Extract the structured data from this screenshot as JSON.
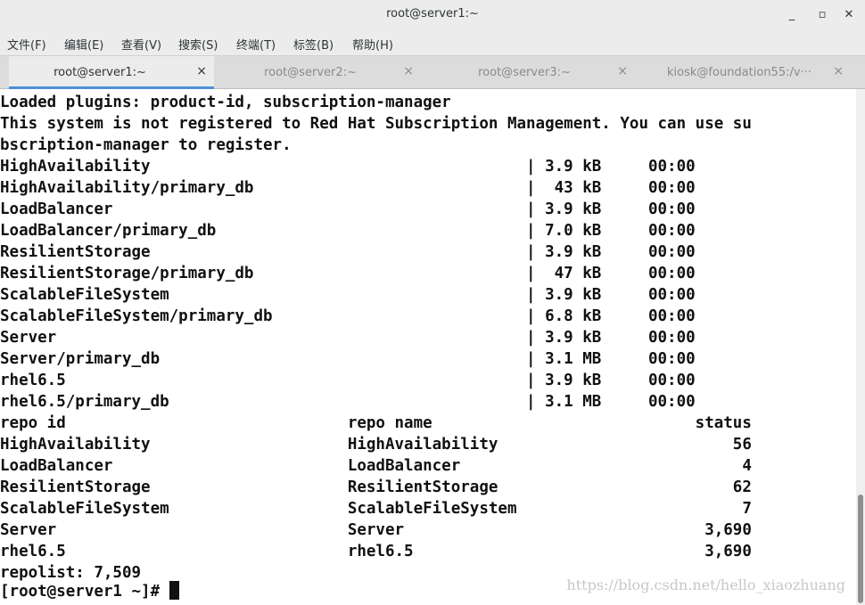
{
  "window": {
    "title": "root@server1:~",
    "minimize_icon": "_",
    "maximize_icon": "▫",
    "close_icon": "✕"
  },
  "menu": [
    "文件(F)",
    "编辑(E)",
    "查看(V)",
    "搜索(S)",
    "终端(T)",
    "标签(B)",
    "帮助(H)"
  ],
  "tabs": [
    {
      "label": "root@server1:~",
      "active": true
    },
    {
      "label": "root@server2:~",
      "active": false
    },
    {
      "label": "root@server3:~",
      "active": false
    },
    {
      "label": "kiosk@foundation55:/v···",
      "active": false
    }
  ],
  "tab_close_icon": "×",
  "terminal": {
    "lines": [
      "Loaded plugins: product-id, subscription-manager",
      "This system is not registered to Red Hat Subscription Management. You can use su",
      "bscription-manager to register.",
      "HighAvailability                                        | 3.9 kB     00:00",
      "HighAvailability/primary_db                             |  43 kB     00:00",
      "LoadBalancer                                            | 3.9 kB     00:00",
      "LoadBalancer/primary_db                                 | 7.0 kB     00:00",
      "ResilientStorage                                        | 3.9 kB     00:00",
      "ResilientStorage/primary_db                             |  47 kB     00:00",
      "ScalableFileSystem                                      | 3.9 kB     00:00",
      "ScalableFileSystem/primary_db                           | 6.8 kB     00:00",
      "Server                                                  | 3.9 kB     00:00",
      "Server/primary_db                                       | 3.1 MB     00:00",
      "rhel6.5                                                 | 3.9 kB     00:00",
      "rhel6.5/primary_db                                      | 3.1 MB     00:00",
      "repo id                              repo name                            status",
      "HighAvailability                     HighAvailability                         56",
      "LoadBalancer                         LoadBalancer                              4",
      "ResilientStorage                     ResilientStorage                         62",
      "ScalableFileSystem                   ScalableFileSystem                        7",
      "Server                               Server                                3,690",
      "rhel6.5                              rhel6.5                               3,690",
      "repolist: 7,509"
    ],
    "prompt": "[root@server1 ~]# "
  },
  "watermark": "https://blog.csdn.net/hello_xiaozhuang"
}
